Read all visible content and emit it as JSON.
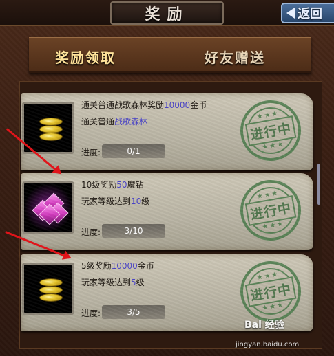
{
  "header": {
    "title": "奖励",
    "back_label": "返回"
  },
  "tabs": [
    {
      "label": "奖励领取",
      "active": true
    },
    {
      "label": "好友赠送",
      "active": false
    }
  ],
  "cards": [
    {
      "title_pre": "通关普通战歌森林奖励",
      "title_hl": "10000",
      "title_post": "金币",
      "desc_pre": "通关普通",
      "desc_hl": "战歌森林",
      "desc_post": "",
      "progress_label": "进度:",
      "progress_value": "0/1",
      "stamp": "进行中",
      "icon": "gold-coin-icon"
    },
    {
      "title_pre": "10级奖励",
      "title_hl": "50",
      "title_post": "魔钻",
      "desc_pre": "玩家等级达到",
      "desc_hl": "10",
      "desc_post": "级",
      "progress_label": "进度:",
      "progress_value": "3/10",
      "stamp": "进行中",
      "icon": "magic-diamond-icon"
    },
    {
      "title_pre": "5级奖励",
      "title_hl": "10000",
      "title_post": "金币",
      "desc_pre": "玩家等级达到",
      "desc_hl": "5",
      "desc_post": "级",
      "progress_label": "进度:",
      "progress_value": "3/5",
      "stamp": "进行中",
      "icon": "gold-coin-icon"
    }
  ],
  "watermark": {
    "text": "Bai 经验",
    "sub": "jingyan.baidu.com"
  },
  "colors": {
    "highlight": "#4a44c8",
    "stamp": "#4a7a4a",
    "arrow": "#e0141a"
  }
}
